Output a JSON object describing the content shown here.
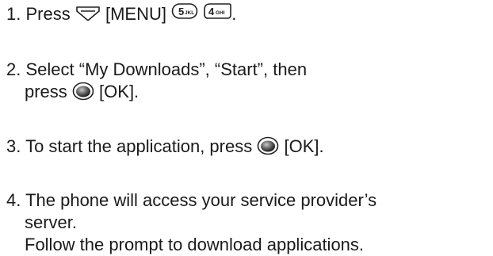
{
  "instructions": {
    "step1": {
      "number": "1.",
      "lead": "Press",
      "menu_key_icon": "soft-key-icon",
      "menu_label": "[MENU]",
      "key1": {
        "digit": "5",
        "letters": "JKL",
        "icon": "key-5-icon"
      },
      "key2": {
        "digit": "4",
        "letters": "GHI",
        "icon": "key-4-icon"
      },
      "end": "."
    },
    "step2": {
      "number": "2.",
      "line1": "Select “My Downloads”, “Start”, then",
      "line2_lead": "press",
      "ok_icon": "ok-key-icon",
      "ok_label": "[OK]."
    },
    "step3": {
      "number": "3.",
      "lead": "To start the application, press",
      "ok_icon": "ok-key-icon",
      "ok_label": "[OK]."
    },
    "step4": {
      "number": "4.",
      "line1": "The phone will access your service provider’s",
      "line2": "server.",
      "line3": "Follow the prompt to download applications."
    }
  }
}
